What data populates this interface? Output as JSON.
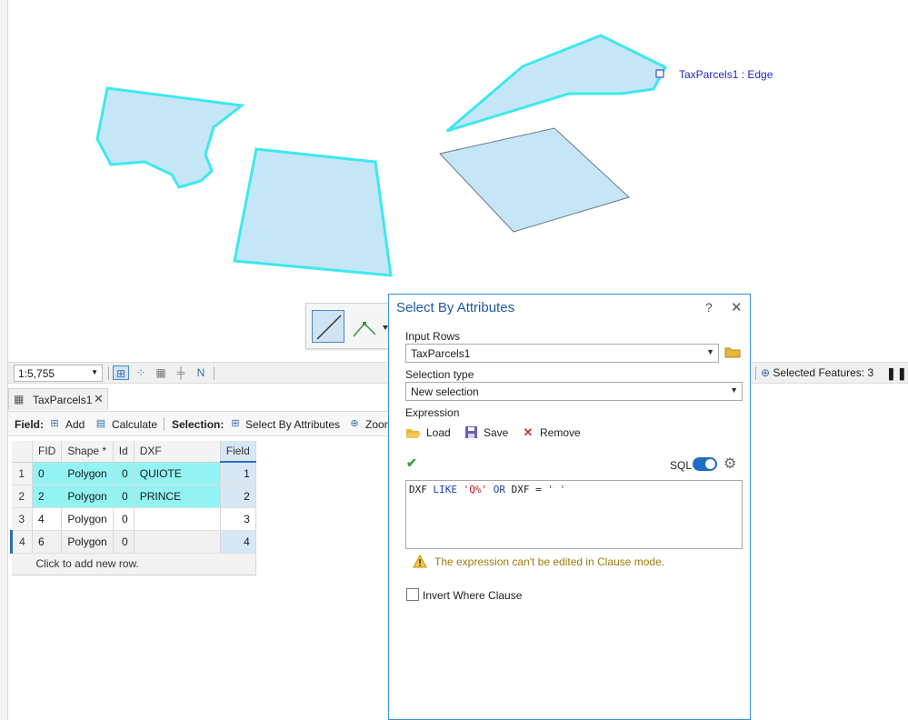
{
  "map": {
    "edge_label": "TaxParcels1 : Edge",
    "selection_color": "#3ee8ee",
    "fill_color": "#c5e6f7"
  },
  "status_bar": {
    "scale": "1:5,755",
    "selected_features": "Selected Features: 3"
  },
  "table": {
    "tab_label": "TaxParcels1",
    "toolbar": {
      "field_label": "Field:",
      "add_label": "Add",
      "calculate_label": "Calculate",
      "selection_label": "Selection:",
      "select_by_attributes_label": "Select By Attributes",
      "zoom_label": "Zoom"
    },
    "columns": [
      "FID",
      "Shape *",
      "Id",
      "DXF",
      "Field"
    ],
    "rows": [
      {
        "num": "1",
        "fid": "0",
        "shape": "Polygon",
        "id": "0",
        "dxf": "QUIOTE",
        "field": "1"
      },
      {
        "num": "2",
        "fid": "2",
        "shape": "Polygon",
        "id": "0",
        "dxf": "PRINCE",
        "field": "2"
      },
      {
        "num": "3",
        "fid": "4",
        "shape": "Polygon",
        "id": "0",
        "dxf": "",
        "field": "3"
      },
      {
        "num": "4",
        "fid": "6",
        "shape": "Polygon",
        "id": "0",
        "dxf": "",
        "field": "4"
      }
    ],
    "add_row_text": "Click to add new row."
  },
  "dialog": {
    "title": "Select By Attributes",
    "help": "?",
    "close": "✕",
    "input_rows_label": "Input Rows",
    "input_rows_value": "TaxParcels1",
    "selection_type_label": "Selection type",
    "selection_type_value": "New selection",
    "expression_label": "Expression",
    "load_label": "Load",
    "save_label": "Save",
    "remove_label": "Remove",
    "sql_label": "SQL",
    "expression": {
      "t1": "DXF ",
      "t2": "LIKE ",
      "t3": "'Q%'",
      "t4": " ",
      "t5": "OR ",
      "t6": "DXF = ",
      "t7": "' '"
    },
    "warning_text": "The expression can't be edited in Clause mode.",
    "invert_label": "Invert Where Clause"
  }
}
